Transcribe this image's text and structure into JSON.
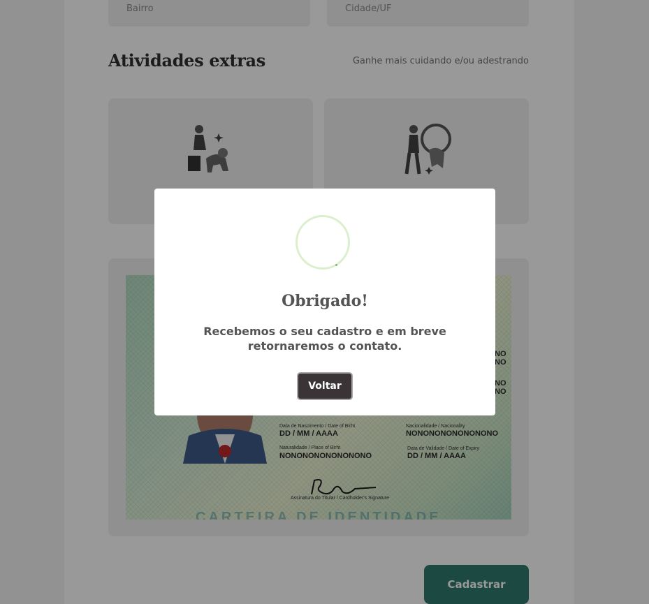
{
  "form": {
    "fields": [
      {
        "placeholder": "Bairro"
      },
      {
        "placeholder": "Cidade/UF"
      }
    ]
  },
  "extras": {
    "title": "Atividades extras",
    "subtitle": "Ganhe mais cuidando e/ou adestrando",
    "cards": [
      {
        "icon": "pet-sitter-icon"
      },
      {
        "icon": "dog-trainer-icon"
      }
    ]
  },
  "document": {
    "labels": {
      "birth": "Data de Nascimento / Date of Birht",
      "nationality": "Nacionalidade / Nacionality",
      "place": "Naturalidade / Place of Birht",
      "expiry": "Data de Validade / Date of Expiry",
      "signature": "Assinatura do Titular / Cardholder's Signature"
    },
    "values": {
      "birth": "DD / MM / AAAA",
      "nationality": "NONONONONONONONO",
      "place": "NONONONONONONONO",
      "expiry": "DD / MM / AAAA",
      "partial1": "NO",
      "partial2": "NO",
      "partial3": "NO",
      "partial4": "NO"
    },
    "footer": "CARTEIRA DE IDENTIDADE"
  },
  "submit_label": "Cadastrar",
  "modal": {
    "title": "Obrigado!",
    "message": "Recebemos o seu cadastro e em breve retornaremos o contato.",
    "button": "Voltar"
  },
  "colors": {
    "accent": "#2f7a6e",
    "modal_button": "#3a3436",
    "spinner": "#dcefcc"
  }
}
